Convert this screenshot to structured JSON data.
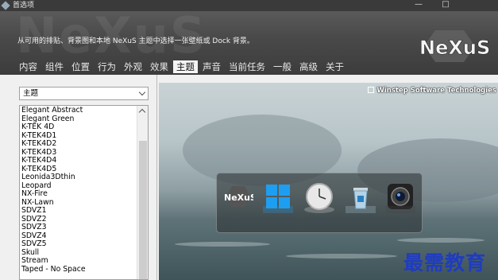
{
  "window": {
    "title": "首选项",
    "minimize_glyph": "—",
    "maximize_glyph": "□"
  },
  "header": {
    "watermark": "NeXuS",
    "description": "从可用的排贴、背景图和本地 NeXuS 主题中选择一张壁纸或 Dock 背景。",
    "logo_text": "NeXuS"
  },
  "tabs": [
    {
      "label": "内容",
      "active": false
    },
    {
      "label": "组件",
      "active": false
    },
    {
      "label": "位置",
      "active": false
    },
    {
      "label": "行为",
      "active": false
    },
    {
      "label": "外观",
      "active": false
    },
    {
      "label": "效果",
      "active": false
    },
    {
      "label": "主题",
      "active": true
    },
    {
      "label": "声音",
      "active": false
    },
    {
      "label": "当前任务",
      "active": false
    },
    {
      "label": "一般",
      "active": false
    },
    {
      "label": "高级",
      "active": false
    },
    {
      "label": "关于",
      "active": false
    }
  ],
  "theme_selector": {
    "selected": "主题"
  },
  "theme_list": [
    "Elegant Abstract",
    "Elegant Green",
    "K-TEK 4D",
    "K-TEK4D1",
    "K-TEK4D2",
    "K-TEK4D3",
    "K-TEK4D4",
    "K-TEK4D5",
    "Leonida3Dthin",
    "Leopard",
    "NX-Fire",
    "NX-Lawn",
    "SDVZ1",
    "SDVZ2",
    "SDVZ3",
    "SDVZ4",
    "SDVZ5",
    "Skull",
    "Stream",
    "Taped - No Space"
  ],
  "preview": {
    "credit": "Winstep Software Technologies",
    "dock_icons": [
      "nexus-icon",
      "windows-icon",
      "clock-icon",
      "recycle-bin-icon",
      "camera-icon"
    ],
    "dock_logo_text": "NeXuS"
  },
  "overlay_caption": "最需教育"
}
